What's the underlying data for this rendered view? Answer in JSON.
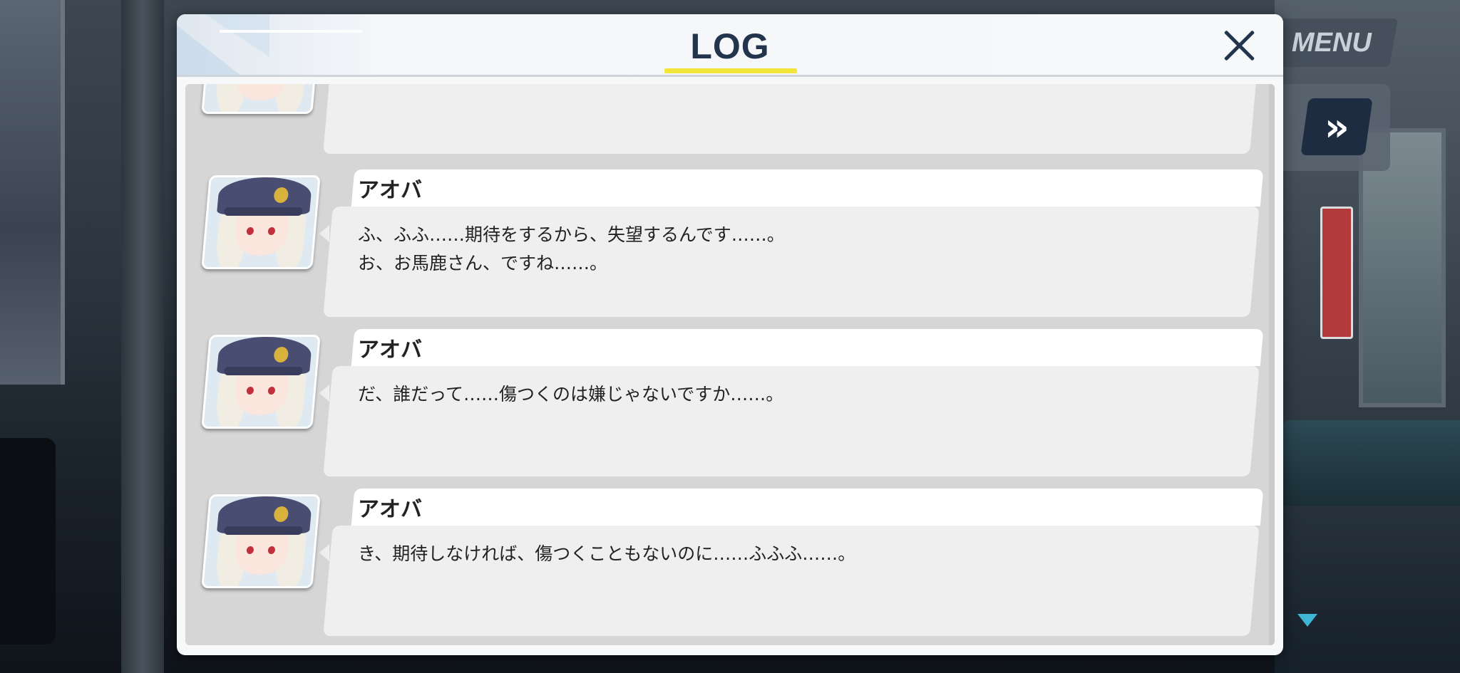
{
  "hud": {
    "menu_label": "MENU",
    "skip_label": "»"
  },
  "log": {
    "title": "LOG",
    "entries": [
      {
        "speaker": "",
        "text": ""
      },
      {
        "speaker": "アオバ",
        "text": "ふ、ふふ……期待をするから、失望するんです……。\nお、お馬鹿さん、ですね……。"
      },
      {
        "speaker": "アオバ",
        "text": "だ、誰だって……傷つくのは嫌じゃないですか……。"
      },
      {
        "speaker": "アオバ",
        "text": "き、期待しなければ、傷つくこともないのに……ふふふ……。"
      }
    ]
  },
  "colors": {
    "title_text": "#23344d",
    "title_underline": "#f2e63b",
    "namebar": "#ffffff",
    "bubble": "#efefef",
    "list_bg": "#d6d6d6"
  }
}
